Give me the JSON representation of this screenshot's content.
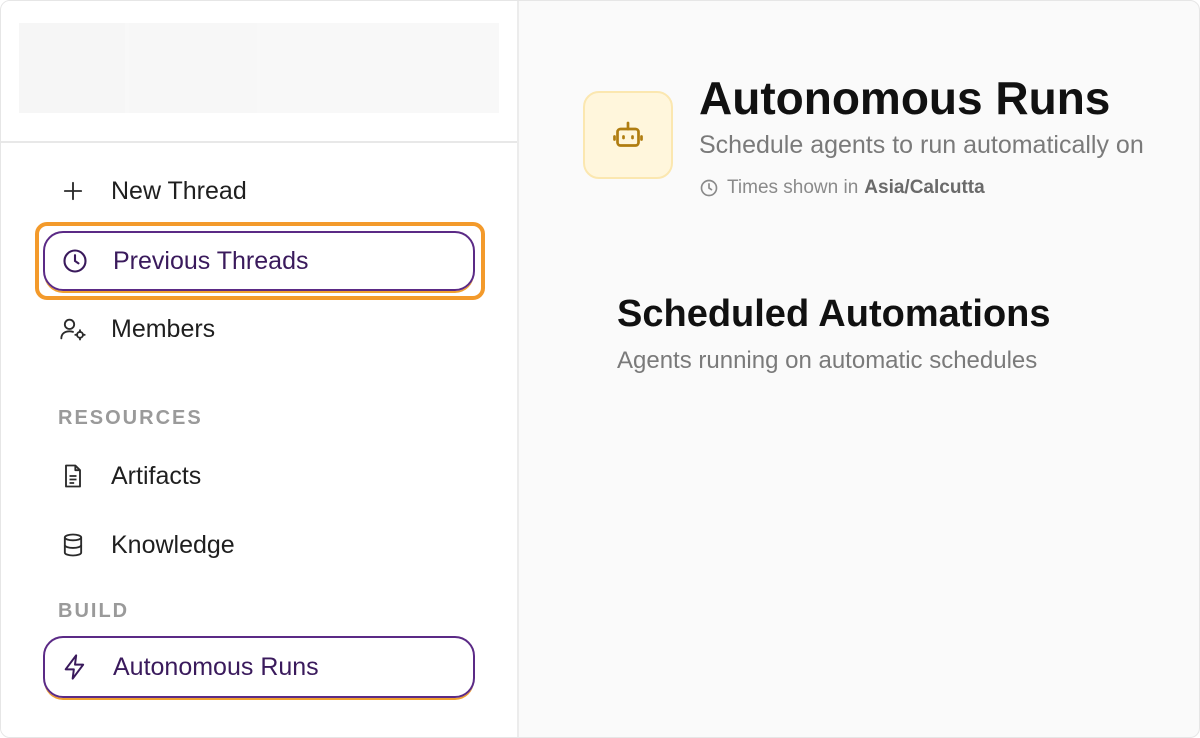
{
  "sidebar": {
    "items": [
      {
        "label": "New Thread"
      },
      {
        "label": "Previous Threads"
      },
      {
        "label": "Members"
      },
      {
        "label": "Artifacts"
      },
      {
        "label": "Knowledge"
      },
      {
        "label": "Autonomous Runs"
      }
    ],
    "sections": {
      "resources": "RESOURCES",
      "build": "BUILD"
    }
  },
  "main": {
    "title": "Autonomous Runs",
    "subtitle": "Schedule agents to run automatically on",
    "timezone_prefix": "Times shown in",
    "timezone": "Asia/Calcutta",
    "section_title": "Scheduled Automations",
    "section_subtitle": "Agents running on automatic schedules"
  },
  "icons": {
    "new_thread": "plus-icon",
    "previous_threads": "clock-icon",
    "members": "user-settings-icon",
    "artifacts": "document-icon",
    "knowledge": "database-icon",
    "autonomous_runs": "lightning-icon",
    "header": "robot-icon",
    "timezone": "clock-icon"
  },
  "colors": {
    "focus_ring": "#f39a2b",
    "active_border": "#5b2a86",
    "header_icon_bg": "#fff6dc"
  }
}
